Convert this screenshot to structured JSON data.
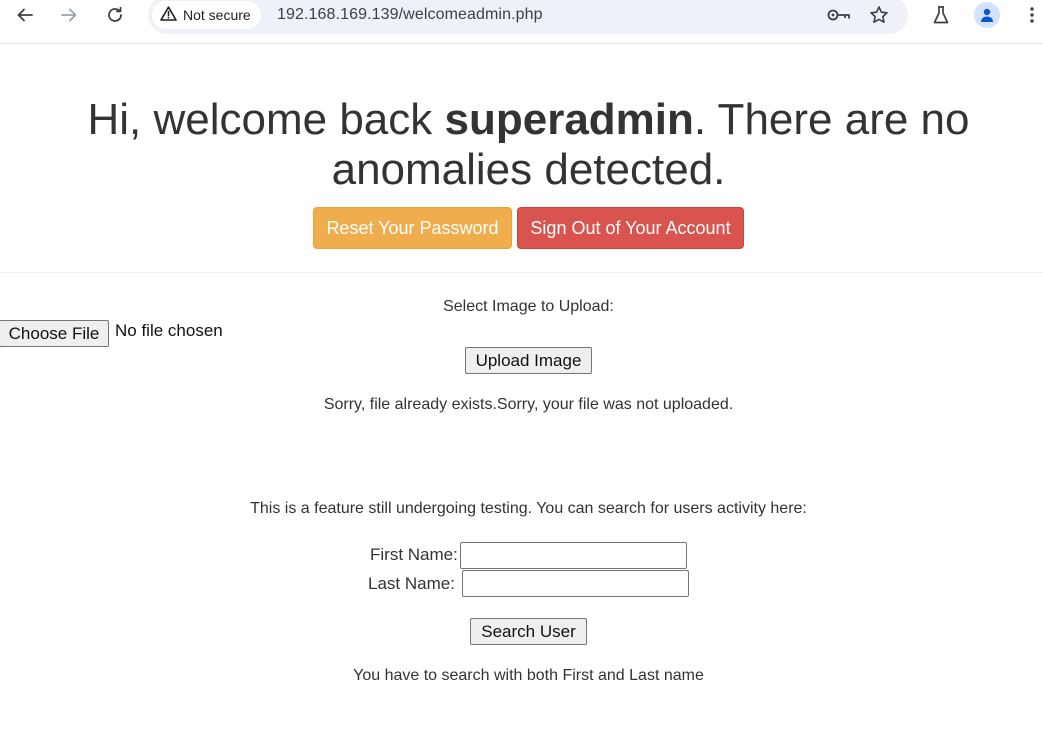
{
  "browser": {
    "security_label": "Not secure",
    "url": "192.168.169.139/welcomeadmin.php",
    "icons": [
      "back-icon",
      "forward-icon",
      "reload-icon",
      "warning-icon",
      "password-key-icon",
      "bookmark-star-icon",
      "labs-flask-icon",
      "profile-icon",
      "menu-dots-icon"
    ]
  },
  "header": {
    "greeting_prefix": "Hi, welcome back ",
    "username": "superadmin",
    "greeting_suffix": ". There are no anomalies detected."
  },
  "actions": {
    "reset_label": "Reset Your Password",
    "signout_label": "Sign Out of Your Account"
  },
  "upload": {
    "prompt": "Select Image to Upload:",
    "choose_label": "Choose File",
    "file_status": "No file chosen",
    "upload_label": "Upload Image",
    "result_message": "Sorry, file already exists.Sorry, your file was not uploaded."
  },
  "search": {
    "intro": "This is a feature still undergoing testing. You can search for users activity here:",
    "first_name_label": "First Name:",
    "first_name_value": "",
    "last_name_label": "Last Name:",
    "last_name_value": "",
    "search_label": "Search User",
    "hint": "You have to search with both First and Last name"
  },
  "colors": {
    "warning": "#f0ad4e",
    "danger": "#d9534f",
    "omnibox": "#eef1f8"
  }
}
